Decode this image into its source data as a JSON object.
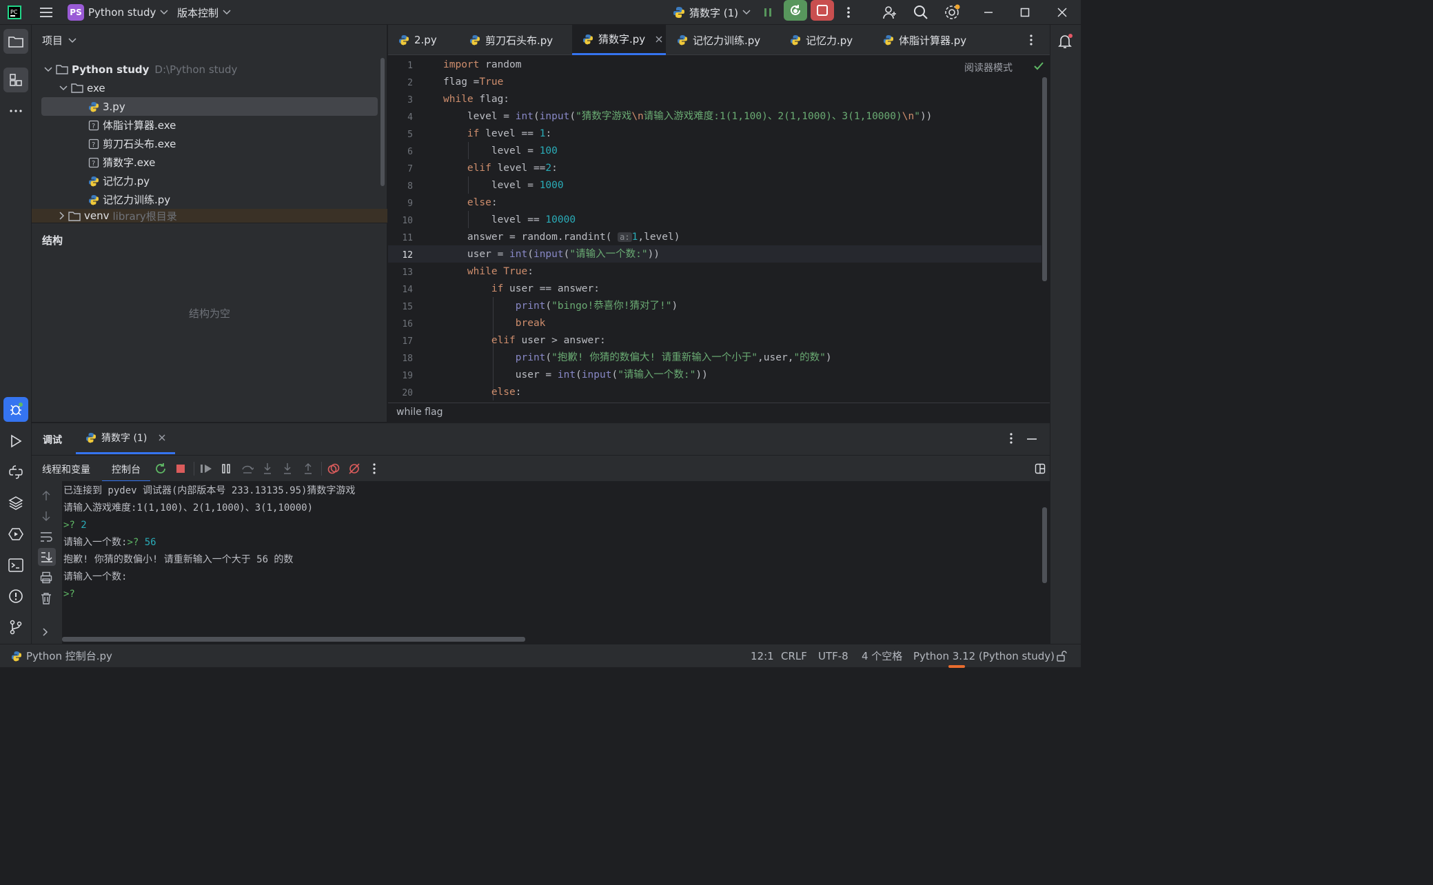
{
  "titlebar": {
    "project_badge": "PS",
    "project_name": "Python study",
    "vcs_label": "版本控制",
    "run_config": "猜数字 (1)"
  },
  "project_panel": {
    "title": "项目",
    "root_name": "Python study",
    "root_path": "D:\\Python study",
    "folder_exe": "exe",
    "files": [
      {
        "name": "3.py",
        "type": "py"
      },
      {
        "name": "体脂计算器.exe",
        "type": "exe"
      },
      {
        "name": "剪刀石头布.exe",
        "type": "exe"
      },
      {
        "name": "猜数字.exe",
        "type": "exe"
      },
      {
        "name": "记忆力.py",
        "type": "py"
      },
      {
        "name": "记忆力训练.py",
        "type": "py"
      }
    ],
    "venv_name": "venv",
    "venv_hint": "library根目录"
  },
  "structure_panel": {
    "title": "结构",
    "empty_text": "结构为空"
  },
  "editor": {
    "tabs": [
      "2.py",
      "剪刀石头布.py",
      "猜数字.py",
      "记忆力训练.py",
      "记忆力.py",
      "体脂计算器.py"
    ],
    "active_tab": "猜数字.py",
    "reader_mode": "阅读器模式",
    "line_numbers": [
      "1",
      "2",
      "3",
      "4",
      "5",
      "6",
      "7",
      "8",
      "9",
      "10",
      "11",
      "12",
      "13",
      "14",
      "15",
      "16",
      "17",
      "18",
      "19",
      "20"
    ],
    "breadcrumb": "while flag",
    "hint_a": "a:"
  },
  "debug": {
    "tab_debug": "调试",
    "session_tab": "猜数字 (1)",
    "sub_threads": "线程和变量",
    "sub_console": "控制台",
    "console_lines": [
      {
        "text": "已连接到 pydev 调试器(内部版本号 233.13135.95)猜数字游戏"
      },
      {
        "text": "请输入游戏难度:1(1,100)、2(1,1000)、3(1,10000)"
      },
      {
        "prompt": ">? ",
        "input": "2"
      },
      {
        "text": "请输入一个数:",
        "prompt": ">? ",
        "input": "56"
      },
      {
        "text": "抱歉! 你猜的数偏小! 请重新输入一个大于 56 的数"
      },
      {
        "text": "请输入一个数:"
      },
      {
        "prompt": ">?",
        "input": ""
      }
    ]
  },
  "statusbar": {
    "left": "Python 控制台.py",
    "position": "12:1",
    "line_sep": "CRLF",
    "encoding": "UTF-8",
    "indent": "4 个空格",
    "interpreter": "Python 3.12 (Python study)"
  },
  "colors": {
    "accent": "#3574f0",
    "run_green": "#57965c",
    "stop_red": "#c94f4f",
    "keyword": "#cf8e6d",
    "string": "#6aab73",
    "number": "#2aacb8"
  }
}
